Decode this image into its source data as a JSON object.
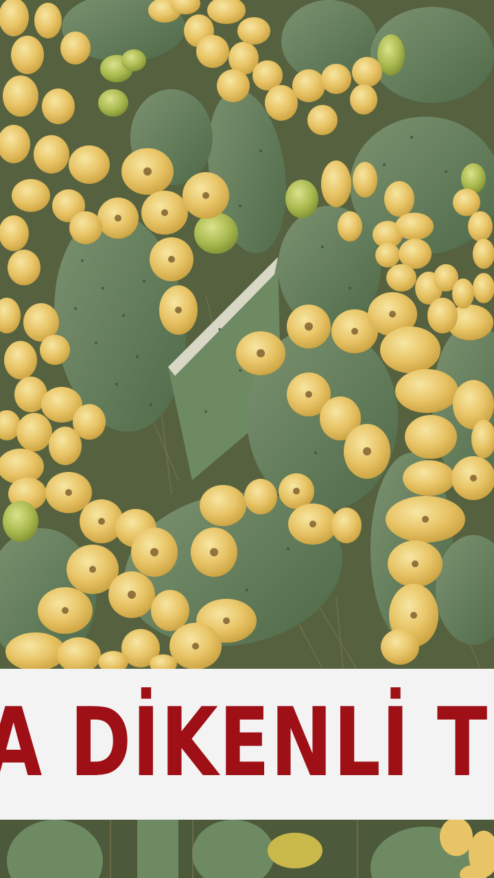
{
  "headline": {
    "text": "A DİKENLİ TEHL"
  },
  "colors": {
    "banner_background": "#f3f3f3",
    "headline_text": "#9e0f16",
    "cactus_pad": "#5f7a56",
    "fruit": "#e9c86a"
  },
  "image": {
    "subject": "prickly-pear-cactus-with-fruit"
  }
}
